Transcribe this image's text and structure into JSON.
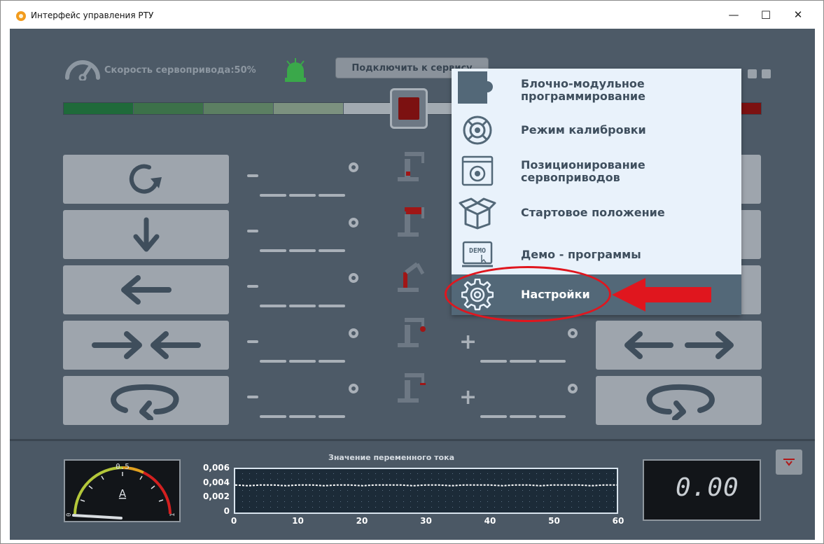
{
  "window": {
    "title": "Интерфейс управления РТУ",
    "minimize": "—",
    "maximize": "☐",
    "close": "✕"
  },
  "header": {
    "speed_label": "Скорость сервопривода:50%",
    "speed_percent": 50,
    "connect_button": "Подключить к сервису"
  },
  "colors": {
    "background": "#4d5a67",
    "accent_red": "#e0161e",
    "beacon_green": "#3aa84a",
    "menu_bg": "#e9f2fb",
    "menu_active": "#536878"
  },
  "controls_left": [
    {
      "icon": "rotate-clockwise-icon"
    },
    {
      "icon": "arrow-down-icon"
    },
    {
      "icon": "arrow-left-icon"
    },
    {
      "icon": "arrows-inward-icon"
    },
    {
      "icon": "rotate-bottom-icon"
    }
  ],
  "controls_right": [
    {
      "icon": "arrows-outward-icon"
    },
    {
      "icon": "rotate-bottom-reverse-icon"
    }
  ],
  "minus_sign": "−",
  "plus_sign": "+",
  "menu": {
    "items": [
      {
        "label_line1": "Блочно-модульное",
        "label_line2": "программирование",
        "icon": "puzzle-icon"
      },
      {
        "label_line1": "Режим калибровки",
        "label_line2": "",
        "icon": "calibration-icon"
      },
      {
        "label_line1": "Позиционирование",
        "label_line2": "сервоприводов",
        "icon": "positioning-icon"
      },
      {
        "label_line1": "Стартовое положение",
        "label_line2": "",
        "icon": "box-icon"
      },
      {
        "label_line1": "Демо - программы",
        "label_line2": "",
        "icon": "demo-icon"
      },
      {
        "label_line1": "Настройки",
        "label_line2": "",
        "icon": "gear-icon",
        "active": true
      }
    ],
    "demo_icon_text": "DEMO"
  },
  "gauge": {
    "unit": "A",
    "top_label": "0.5",
    "min_label": "0",
    "max_label": "1"
  },
  "chart_data": {
    "type": "line",
    "title": "Значение переменного тока",
    "x_ticks": [
      "0",
      "10",
      "20",
      "30",
      "40",
      "50",
      "60"
    ],
    "y_ticks": [
      "0,006",
      "0,004",
      "0,002",
      "0"
    ],
    "xlim": [
      0,
      60
    ],
    "ylim": [
      0,
      0.006
    ],
    "series": [
      {
        "values": [
          0.0038,
          0.0037,
          0.0038,
          0.0038,
          0.0037,
          0.0038,
          0.0038,
          0.0037,
          0.0038,
          0.0038,
          0.0037,
          0.0038,
          0.0038,
          0.0038,
          0.0037,
          0.0038,
          0.0038,
          0.0037,
          0.0038,
          0.0038,
          0.0038,
          0.0037,
          0.0038,
          0.0038,
          0.0037,
          0.0038,
          0.0038,
          0.0038,
          0.0037,
          0.0038,
          0.0038
        ]
      }
    ]
  },
  "digital_readout": {
    "value": "0.00"
  }
}
